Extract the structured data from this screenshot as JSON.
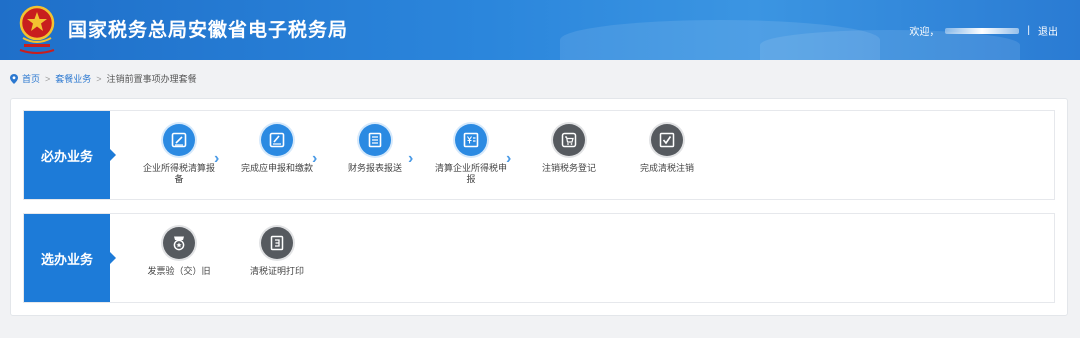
{
  "header": {
    "title": "国家税务总局安徽省电子税务局",
    "logo_icon": "tax-bureau-emblem",
    "welcome": "欢迎，",
    "separator": "|",
    "logout": "退出"
  },
  "breadcrumb": {
    "home": "首页",
    "level2": "套餐业务",
    "current": "注销前置事项办理套餐",
    "sep": ">"
  },
  "required": {
    "label": "必办业务",
    "items": [
      {
        "label": "企业所得税清算报备",
        "icon": "edit-icon",
        "color": "#2b8ae2"
      },
      {
        "label": "完成应申报和缴款",
        "icon": "edit-icon",
        "color": "#2b8ae2"
      },
      {
        "label": "财务报表报送",
        "icon": "document-icon",
        "color": "#2b8ae2"
      },
      {
        "label": "清算企业所得税申报",
        "icon": "yen-form-icon",
        "color": "#2b8ae2"
      },
      {
        "label": "注销税务登记",
        "icon": "cart-icon",
        "color": "#565a5f"
      },
      {
        "label": "完成清税注销",
        "icon": "checkbox-icon",
        "color": "#565a5f"
      }
    ]
  },
  "optional": {
    "label": "选办业务",
    "items": [
      {
        "label": "发票验（交）旧",
        "icon": "medal-icon",
        "color": "#565a5f"
      },
      {
        "label": "清税证明打印",
        "icon": "certificate-icon",
        "color": "#565a5f"
      }
    ]
  }
}
